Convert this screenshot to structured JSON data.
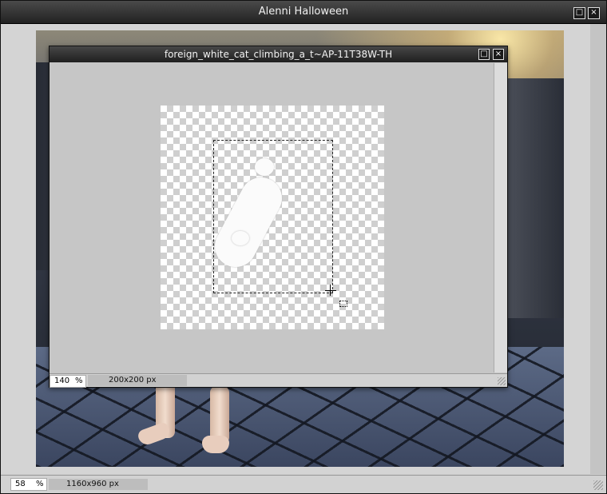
{
  "outer_window": {
    "title": "Alenni Halloween",
    "zoom_value": "58",
    "zoom_unit": "%",
    "image_size": "1160x960 px"
  },
  "inner_window": {
    "title": "foreign_white_cat_climbing_a_t~AP-11T38W-TH",
    "zoom_value": "140",
    "zoom_unit": "%",
    "image_size": "200x200 px"
  },
  "icons": {
    "maximize": "maximize-icon",
    "close": "close-icon",
    "cursor": "move-crosshair-icon"
  }
}
